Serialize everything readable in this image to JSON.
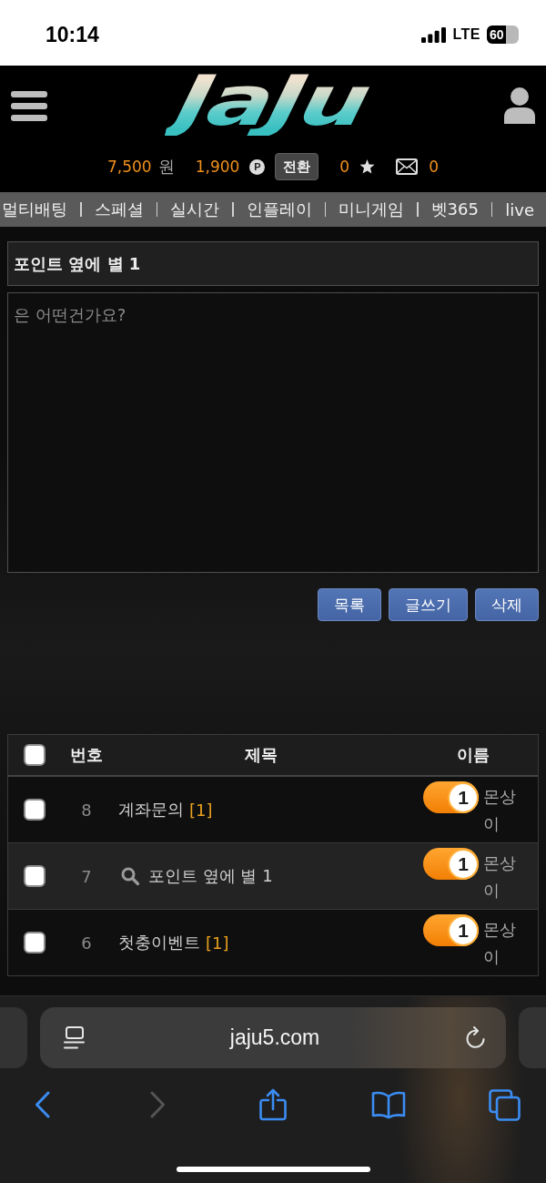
{
  "status_bar": {
    "time": "10:14",
    "network": "LTE",
    "battery": "60"
  },
  "header": {
    "logo": "JaJu"
  },
  "account": {
    "cash": "7,500",
    "cash_unit": "원",
    "points": "1,900",
    "points_symbol": "P",
    "convert_button": "전환",
    "favorites": "0",
    "messages": "0"
  },
  "nav": [
    {
      "label": "멀티배팅"
    },
    {
      "label": "스페셜"
    },
    {
      "label": "실시간"
    },
    {
      "label": "인플레이"
    },
    {
      "label": "미니게임"
    },
    {
      "label": "벳365"
    },
    {
      "label": "live"
    }
  ],
  "post": {
    "title": "포인트 옆에 별 1",
    "content": "은 어떤건가요?"
  },
  "actions": [
    {
      "label": "목록"
    },
    {
      "label": "글쓰기"
    },
    {
      "label": "삭제"
    }
  ],
  "table": {
    "all_checked": false,
    "columns": [
      "번호",
      "제목",
      "이름"
    ],
    "rows": [
      {
        "checked": false,
        "selected": false,
        "number": "8",
        "title": "계좌문의",
        "comments": "[1]",
        "level": "1",
        "name": "몬상이"
      },
      {
        "checked": false,
        "selected": true,
        "number": "7",
        "title": "포인트 옆에 별 1",
        "level": "1",
        "name": "몬상이"
      },
      {
        "checked": false,
        "selected": false,
        "number": "6",
        "title": "첫충이벤트",
        "comments": "[1]",
        "level": "1",
        "name": "몬상이"
      }
    ]
  },
  "browser": {
    "url": "jaju5.com",
    "toolbar": [
      {
        "kind": "back",
        "disabled": false
      },
      {
        "kind": "forward",
        "disabled": true
      },
      {
        "kind": "share",
        "disabled": false
      },
      {
        "kind": "bookmarks",
        "disabled": false
      },
      {
        "kind": "tabs",
        "disabled": false
      }
    ]
  }
}
